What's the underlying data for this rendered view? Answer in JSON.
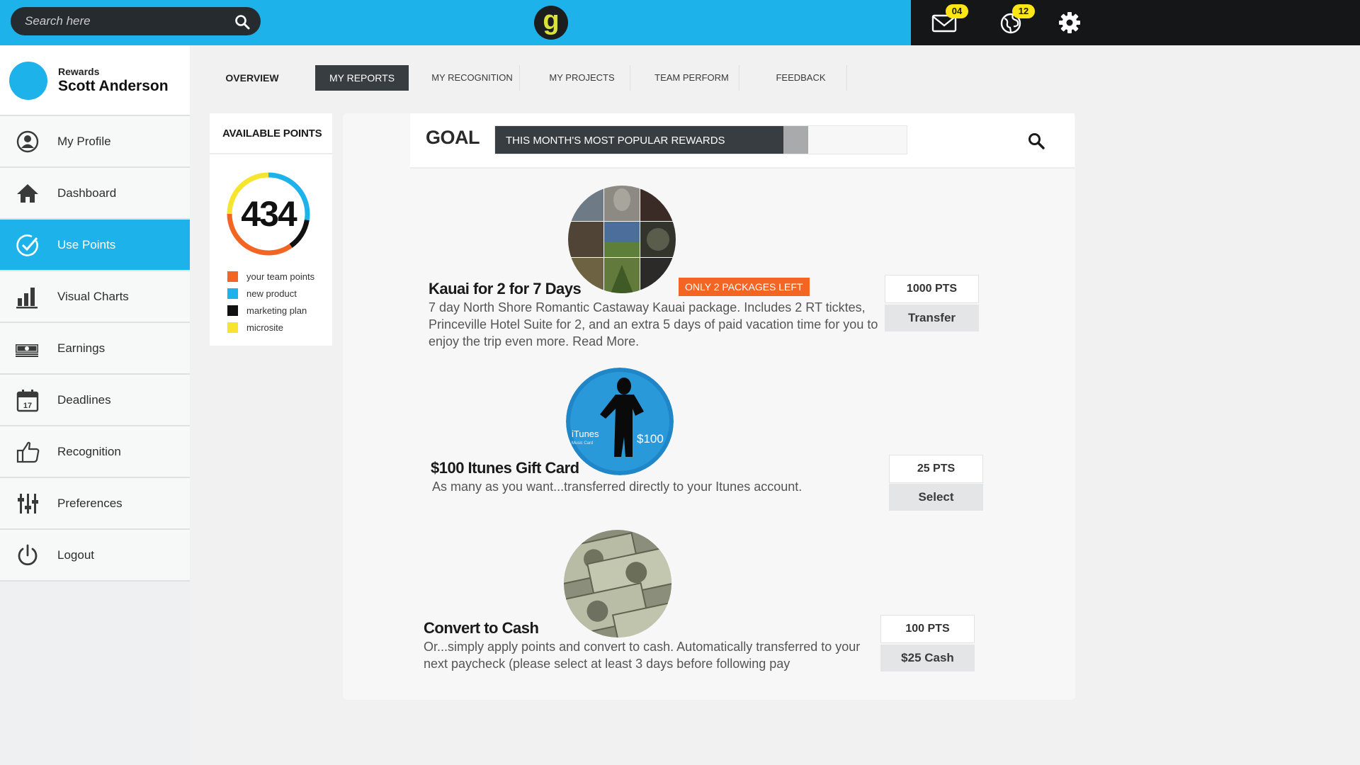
{
  "search": {
    "placeholder": "Search here"
  },
  "logo": {
    "glyph": "g"
  },
  "notifications": {
    "mail_count": "04",
    "globe_count": "12"
  },
  "profile": {
    "section_label": "Rewards",
    "name": "Scott Anderson"
  },
  "sidebar": {
    "items": [
      {
        "label": "My Profile",
        "icon": "user-circle-icon",
        "active": false
      },
      {
        "label": "Dashboard",
        "icon": "home-icon",
        "active": false
      },
      {
        "label": "Use Points",
        "icon": "check-circle-icon",
        "active": true
      },
      {
        "label": "Visual Charts",
        "icon": "bar-chart-icon",
        "active": false
      },
      {
        "label": "Earnings",
        "icon": "money-stack-icon",
        "active": false
      },
      {
        "label": "Deadlines",
        "icon": "calendar-icon",
        "active": false,
        "calendar_day": "17"
      },
      {
        "label": "Recognition",
        "icon": "thumbs-up-icon",
        "active": false
      },
      {
        "label": "Preferences",
        "icon": "sliders-icon",
        "active": false
      },
      {
        "label": "Logout",
        "icon": "power-icon",
        "active": false
      }
    ]
  },
  "tabs": [
    {
      "label": "OVERVIEW",
      "active": false
    },
    {
      "label": "MY REPORTS",
      "active": true
    },
    {
      "label": "MY RECOGNITION",
      "active": false
    },
    {
      "label": "MY PROJECTS",
      "active": false
    },
    {
      "label": "TEAM PERFORM",
      "active": false
    },
    {
      "label": "FEEDBACK",
      "active": false
    }
  ],
  "points": {
    "title": "AVAILABLE POINTS",
    "value": "434",
    "legend": [
      {
        "label": "your team points",
        "color": "#f26522"
      },
      {
        "label": "new product",
        "color": "#1eb2ea"
      },
      {
        "label": "marketing plan",
        "color": "#111111"
      },
      {
        "label": "microsite",
        "color": "#f5e52e"
      }
    ]
  },
  "goal": {
    "label": "GOAL",
    "bar_text": "THIS MONTH'S MOST POPULAR REWARDS",
    "progress_fraction": 0.7
  },
  "rewards": [
    {
      "title": "Kauai for 2 for 7 Days",
      "badge": "ONLY 2 PACKAGES LEFT",
      "description": "7 day North Shore Romantic Castaway Kauai package.  Includes 2 RT ticktes, Princeville Hotel Suite for 2, and an extra 5 days of paid vacation time for you to enjoy the trip even more.  Read More.",
      "points": "1000 PTS",
      "action": "Transfer"
    },
    {
      "title": "$100 Itunes Gift Card",
      "badge": "",
      "image_text": "iTunes",
      "image_subtext": "Music Card",
      "image_amount": "$100",
      "description": "As many as you want...transferred directly to your Itunes account.",
      "points": "25 PTS",
      "action": "Select"
    },
    {
      "title": "Convert to Cash",
      "badge": "",
      "description": "Or...simply apply points and convert to cash.  Automatically transferred to your next paycheck (please select at least 3 days before following pay",
      "points": "100 PTS",
      "action": "$25 Cash"
    }
  ],
  "colors": {
    "accent_blue": "#1eb2ea",
    "dark": "#383d41",
    "badge_yellow": "#ffe614",
    "promo_orange": "#f26522"
  }
}
